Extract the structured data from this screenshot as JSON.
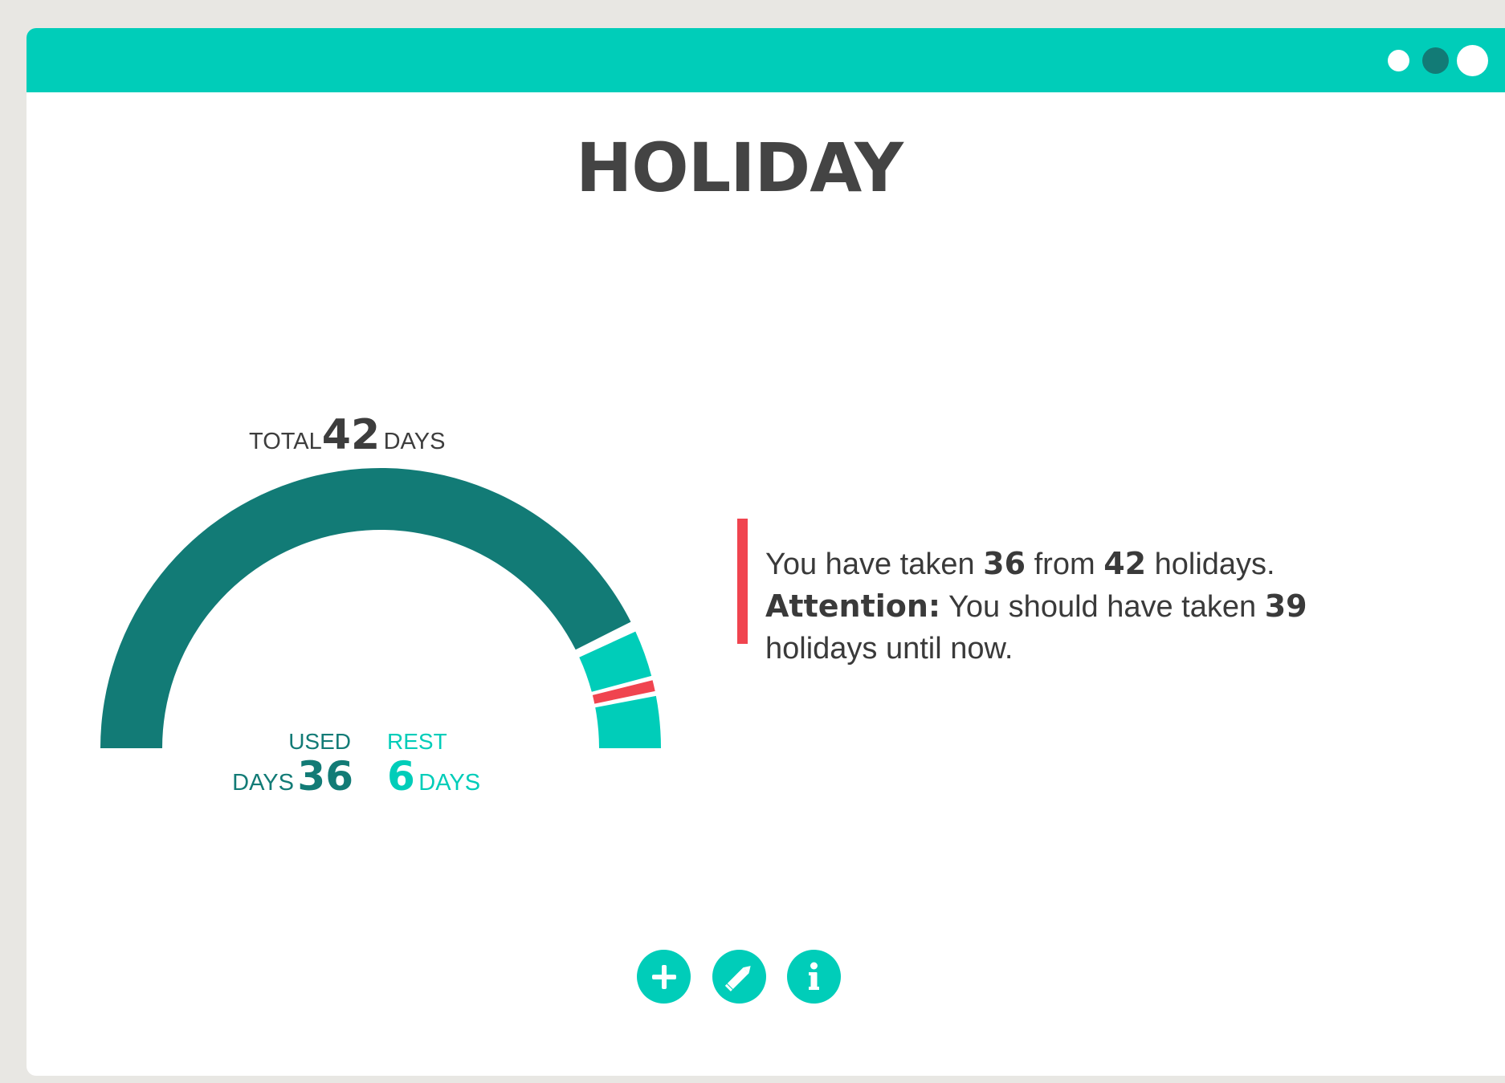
{
  "title": "HOLIDAY",
  "window_controls": [
    "dot-icon",
    "dot-icon",
    "dot-icon"
  ],
  "colors": {
    "accent": "#00cdb9",
    "used": "#127b76",
    "rest": "#00cdb9",
    "warning": "#f0444f",
    "text": "#444444"
  },
  "gauge": {
    "total_label": "TOTAL",
    "total_value": "42",
    "total_unit": "DAYS",
    "used_label": "USED",
    "used_unit": "DAYS",
    "used_value": "36",
    "rest_label": "REST",
    "rest_value": "6",
    "rest_unit": "DAYS",
    "total_days": 42,
    "used_days": 36,
    "expected_days": 39
  },
  "message": {
    "p1": "You have taken ",
    "taken": "36",
    "p2": " from ",
    "total": "42",
    "p3": " holidays.",
    "attention": "Attention:",
    "p4": " You should have taken ",
    "expected": "39",
    "p5": " holidays until now."
  },
  "actions": [
    {
      "icon": "plus-icon"
    },
    {
      "icon": "pencil-icon"
    },
    {
      "icon": "info-icon"
    }
  ]
}
